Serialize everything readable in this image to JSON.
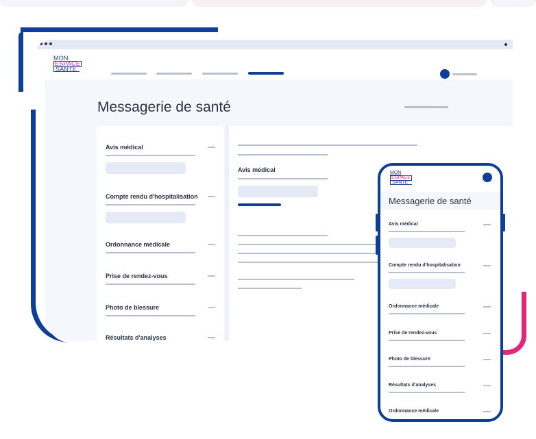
{
  "colors": {
    "brand_blue": "#0c3f95",
    "accent_pink": "#e2287a",
    "placeholder_grey": "#b9bfcd",
    "input_fill": "#e6eaf7",
    "content_bg": "#f6f7fc",
    "text": "#2a3142"
  },
  "logo": {
    "line1": "MON",
    "line2": "ESPACE",
    "line3": "SANTE"
  },
  "icons": {
    "avatar": "user-avatar-icon",
    "window_dots": "window-controls-icon"
  },
  "desktop": {
    "page_title": "Messagerie de santé",
    "list": [
      {
        "label": "Avis médical"
      },
      {
        "label": "Compte rendu d'hospitalisation"
      },
      {
        "label": "Ordonnance médicale"
      },
      {
        "label": "Prise de rendez-vous"
      },
      {
        "label": "Photo de blessure"
      },
      {
        "label": "Résultats d'analyses"
      }
    ],
    "detail": {
      "title": "Avis médical"
    }
  },
  "mobile": {
    "page_title": "Messagerie de santé",
    "list": [
      {
        "label": "Avis médical"
      },
      {
        "label": "Compte rendu d'hospitalisation"
      },
      {
        "label": "Ordonnance médicale"
      },
      {
        "label": "Prise de rendez-vous"
      },
      {
        "label": "Photo de blessure"
      },
      {
        "label": "Résultats d'analyses"
      },
      {
        "label": "Ordonnance médicale"
      }
    ]
  }
}
